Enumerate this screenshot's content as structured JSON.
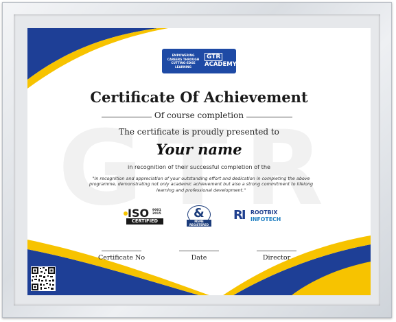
{
  "watermark": "GTR",
  "logo": {
    "tagline": "EMPOWERING CAREERS THROUGH CUTTING-EDGE LEARNING",
    "mark": "GTR",
    "name": "ACADEMY"
  },
  "certificate": {
    "title": "Certificate Of Achievement",
    "subtitle": "Of course completion",
    "presented_text": "The certificate is proudly presented to",
    "recipient": "Your name",
    "recognition_text": "in recognition of their successful completion of the",
    "quote": "\"In recognition and appreciation of your outstanding effort and dedication in completing the above programme, demonstrating not only academic achievement but also a strong commitment to lifelong learning and professional development.\""
  },
  "badges": {
    "iso": {
      "mark": "ISO",
      "years": "9001 2015",
      "label": "CERTIFIED"
    },
    "msme": {
      "mark": "&",
      "label": "MSME REGISTERED"
    },
    "rootbix": {
      "mark": "RI",
      "line1": "ROOTBIX",
      "line2": "INFOTECH"
    }
  },
  "signatures": [
    "Certificate No",
    "Date",
    "Director"
  ],
  "colors": {
    "blue": "#1e3f96",
    "yellow": "#f7c300",
    "frame": "#dcdfe3"
  },
  "icons": [
    "qr-code-icon",
    "iso-badge-icon",
    "msme-badge-icon",
    "rootbix-logo-icon"
  ]
}
